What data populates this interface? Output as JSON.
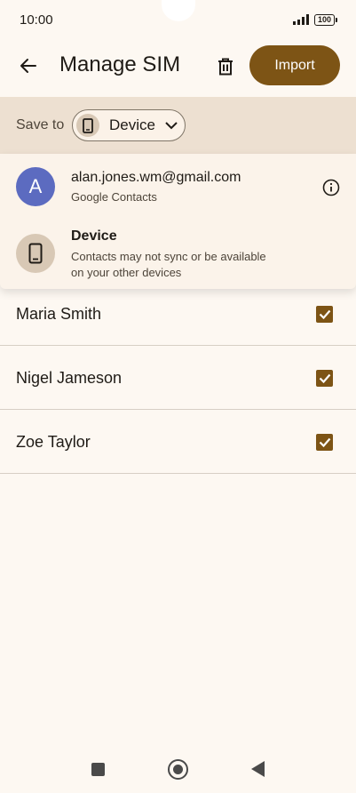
{
  "status_bar": {
    "time": "10:00",
    "battery": "100",
    "icons": [
      "signal-icon",
      "battery-icon"
    ]
  },
  "app_bar": {
    "title": "Manage SIM",
    "back_icon": "arrow-back-icon",
    "delete_icon": "trash-icon",
    "import_label": "Import"
  },
  "save_to": {
    "label": "Save to",
    "selected": "Device",
    "icon": "phone-icon"
  },
  "dropdown": {
    "items": [
      {
        "avatar_letter": "A",
        "primary": "alan.jones.wm@gmail.com",
        "secondary": "Google Contacts",
        "trailing_icon": "info-icon"
      },
      {
        "avatar_icon": "phone-icon",
        "primary": "Device",
        "secondary_line1": "Contacts may not sync or be available",
        "secondary_line2": "on your other devices"
      }
    ]
  },
  "contacts": [
    {
      "name": "Maria Smith",
      "checked": true
    },
    {
      "name": "Nigel Jameson",
      "checked": true
    },
    {
      "name": "Zoe Taylor",
      "checked": true
    }
  ],
  "colors": {
    "accent": "#7d5415",
    "background": "#fdf8f2",
    "save_bar": "#ede0d1",
    "avatar_google": "#5c6bc0"
  },
  "nav_bar": {
    "icons": [
      "recents-icon",
      "home-icon",
      "back-icon"
    ]
  }
}
